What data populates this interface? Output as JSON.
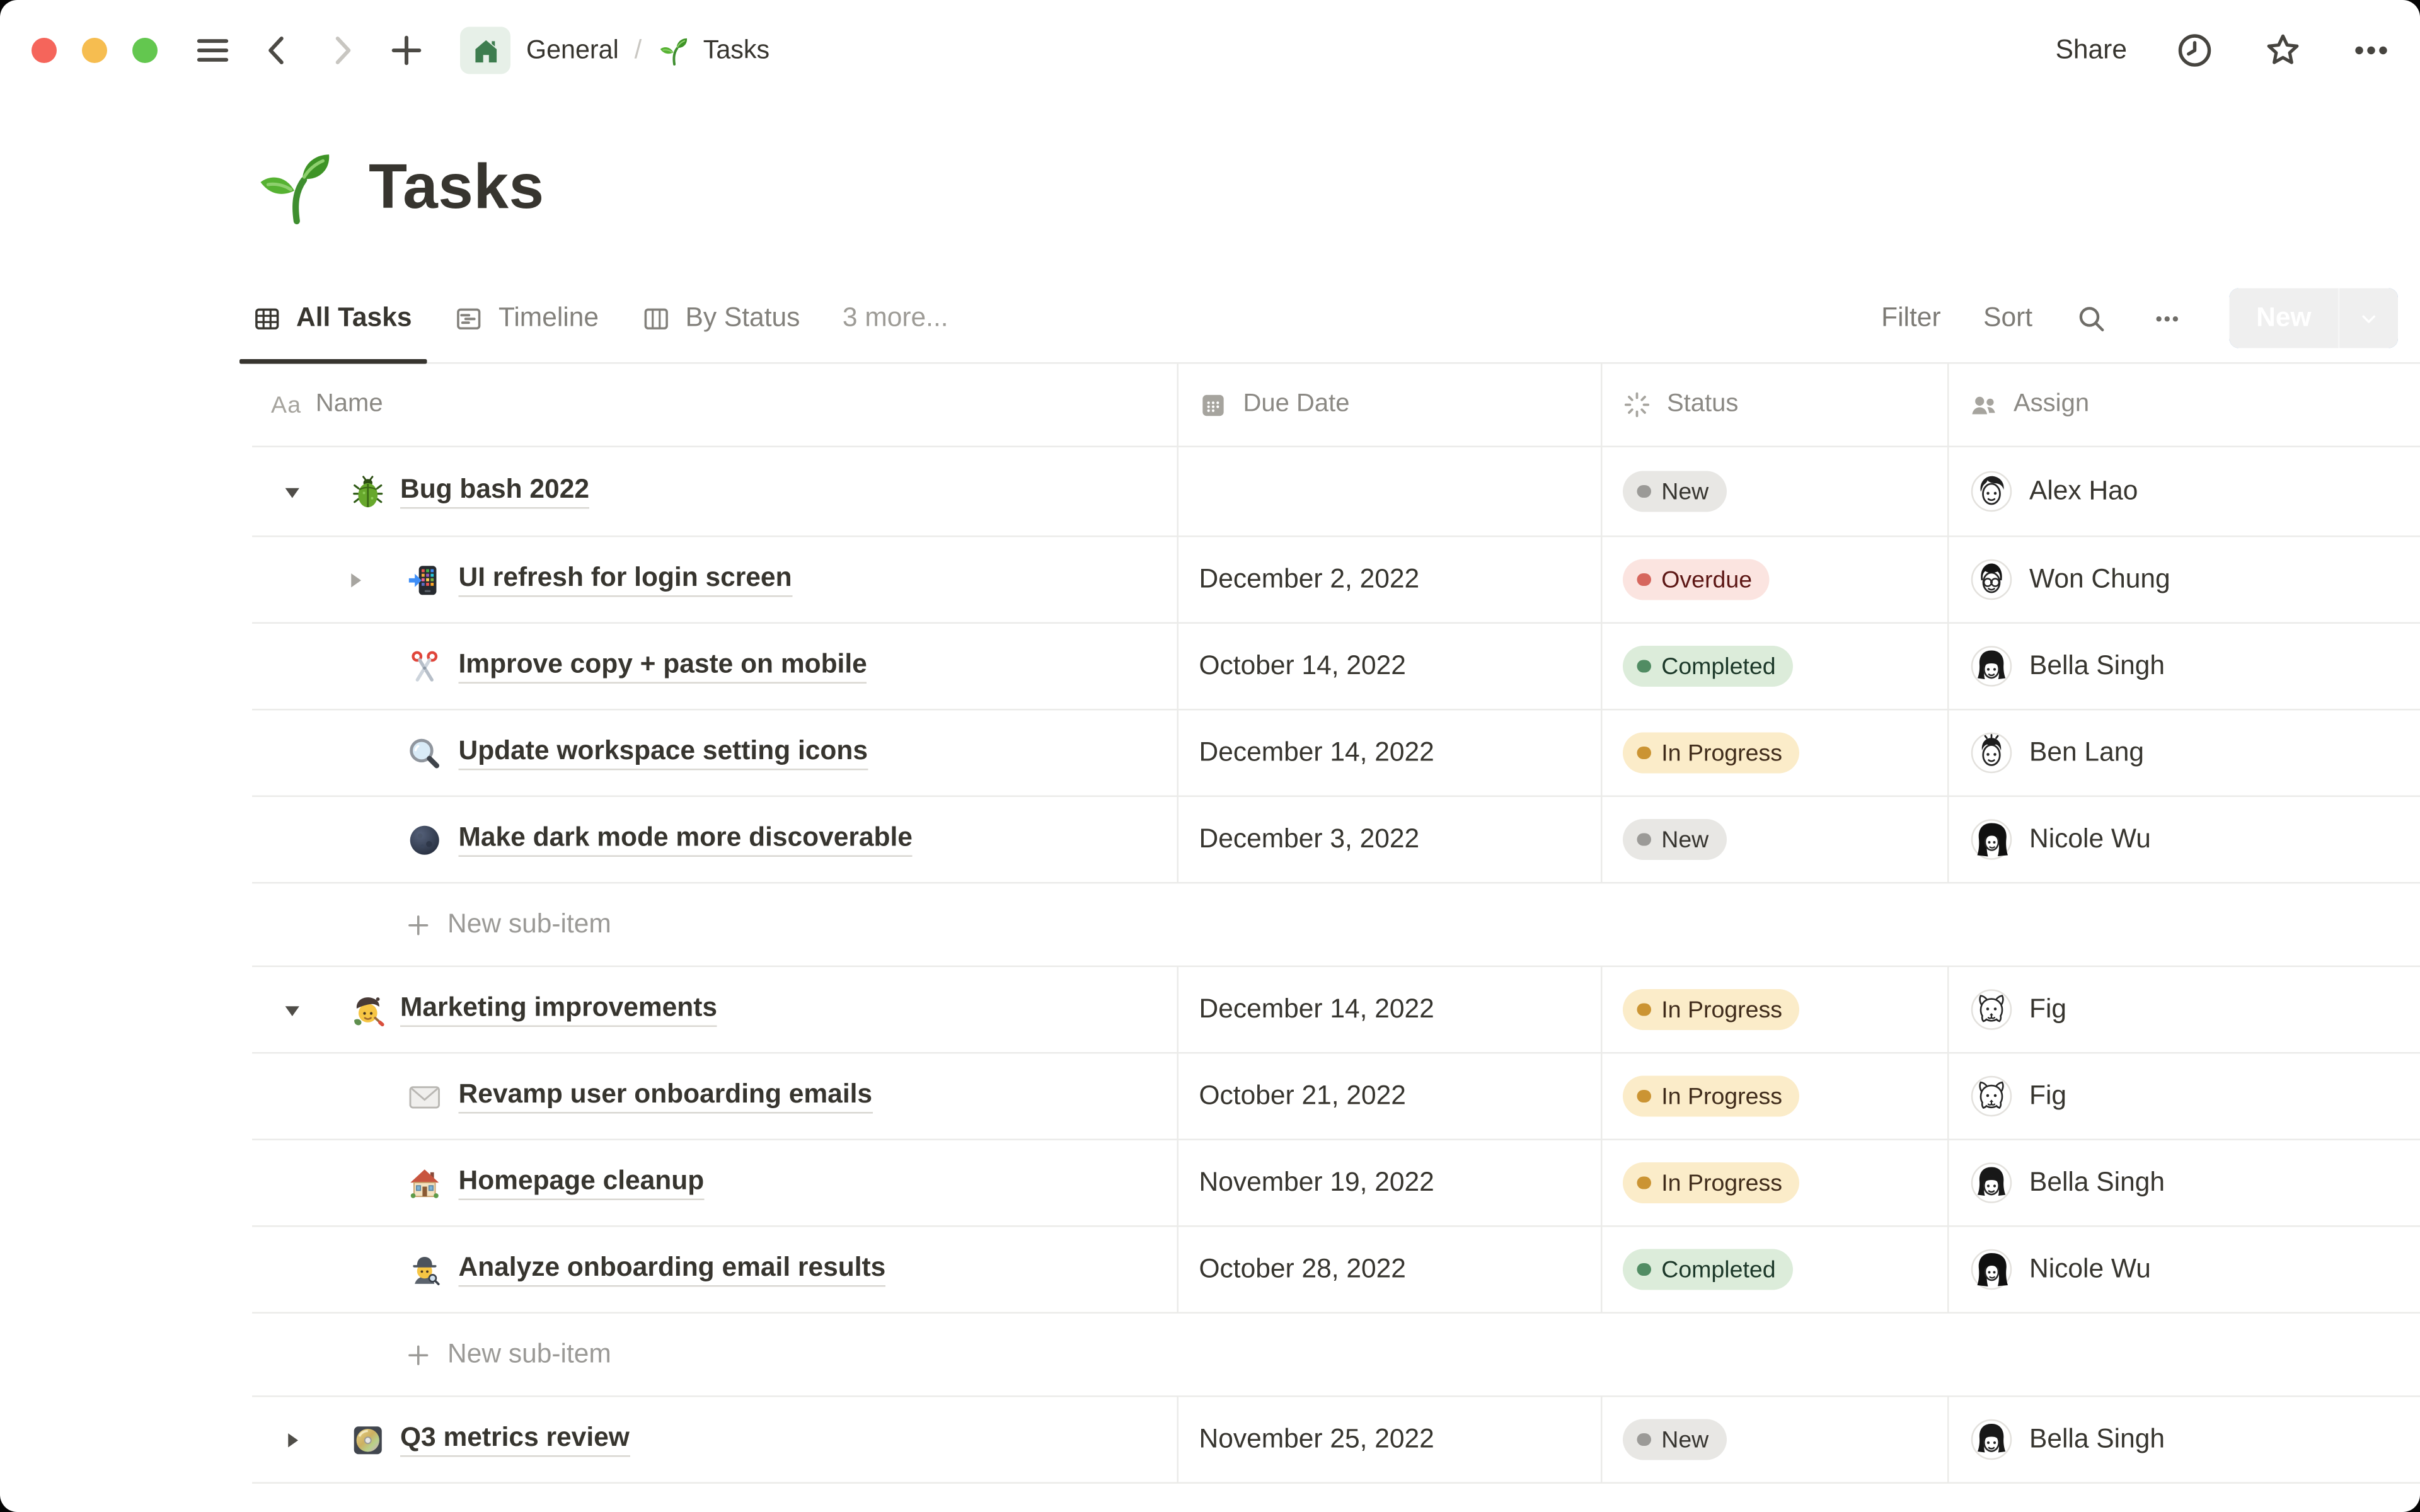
{
  "topbar": {
    "share": "Share",
    "icons": [
      "sidebar-menu",
      "back-chevron",
      "forward-chevron",
      "plus",
      "home",
      "clock",
      "star",
      "ellipsis"
    ]
  },
  "breadcrumb": {
    "workspace": "General",
    "separator": "/",
    "page": "Tasks",
    "page_emoji": "seedling"
  },
  "page": {
    "title": "Tasks",
    "emoji": "seedling"
  },
  "views": {
    "tabs": [
      {
        "label": "All Tasks",
        "icon": "table-grid",
        "active": true
      },
      {
        "label": "Timeline",
        "icon": "timeline",
        "active": false
      },
      {
        "label": "By Status",
        "icon": "board-columns",
        "active": false
      }
    ],
    "more_label": "3 more...",
    "toolbar": {
      "filter": "Filter",
      "sort": "Sort",
      "search_icon": "search",
      "more_icon": "ellipsis",
      "new_label": "New"
    }
  },
  "table": {
    "columns": [
      {
        "label": "Name",
        "icon": "text-Aa"
      },
      {
        "label": "Due Date",
        "icon": "calendar"
      },
      {
        "label": "Status",
        "icon": "status-burst"
      },
      {
        "label": "Assign",
        "icon": "people"
      }
    ],
    "new_sub_item_label": "New sub-item",
    "rows": [
      {
        "type": "task",
        "level": 0,
        "toggle": "open",
        "toggle_tone": "dark",
        "icon": "beetle",
        "name": "Bug bash 2022",
        "due": "",
        "status": "New",
        "assignee": "Alex Hao",
        "avatar": "man-sweep"
      },
      {
        "type": "task",
        "level": 1,
        "toggle": "closed",
        "toggle_tone": "muted",
        "icon": "phone-arrow",
        "name": "UI refresh for login screen",
        "due": "December 2, 2022",
        "status": "Overdue",
        "assignee": "Won Chung",
        "avatar": "man-glasses"
      },
      {
        "type": "task",
        "level": 1,
        "icon": "scissors",
        "name": "Improve copy + paste on mobile",
        "due": "October 14, 2022",
        "status": "Completed",
        "assignee": "Bella Singh",
        "avatar": "woman-bob"
      },
      {
        "type": "task",
        "level": 1,
        "icon": "magnifier",
        "name": "Update workspace setting icons",
        "due": "December 14, 2022",
        "status": "In Progress",
        "assignee": "Ben Lang",
        "avatar": "man-short"
      },
      {
        "type": "task",
        "level": 1,
        "icon": "new-moon",
        "name": "Make dark mode more discoverable",
        "due": "December 3, 2022",
        "status": "New",
        "assignee": "Nicole Wu",
        "avatar": "woman-long"
      },
      {
        "type": "new-sub-item"
      },
      {
        "type": "task",
        "level": 0,
        "toggle": "open",
        "toggle_tone": "dark",
        "icon": "artist",
        "name": "Marketing improvements",
        "due": "December 14, 2022",
        "status": "In Progress",
        "assignee": "Fig",
        "avatar": "dog"
      },
      {
        "type": "task",
        "level": 1,
        "icon": "envelope",
        "name": "Revamp user onboarding emails",
        "due": "October 21, 2022",
        "status": "In Progress",
        "assignee": "Fig",
        "avatar": "dog"
      },
      {
        "type": "task",
        "level": 1,
        "icon": "house",
        "name": "Homepage cleanup",
        "due": "November 19, 2022",
        "status": "In Progress",
        "assignee": "Bella Singh",
        "avatar": "woman-bob"
      },
      {
        "type": "task",
        "level": 1,
        "icon": "detective",
        "name": "Analyze onboarding email results",
        "due": "October 28, 2022",
        "status": "Completed",
        "assignee": "Nicole Wu",
        "avatar": "woman-long"
      },
      {
        "type": "new-sub-item"
      },
      {
        "type": "task",
        "level": 0,
        "toggle": "closed",
        "toggle_tone": "dark",
        "icon": "minidisc",
        "name": "Q3 metrics review",
        "due": "November 25, 2022",
        "status": "New",
        "assignee": "Bella Singh",
        "avatar": "woman-bob"
      }
    ],
    "status_styles": {
      "New": {
        "bg": "#e8e7e4",
        "dot": "#9b9a97",
        "text": "#373530"
      },
      "Overdue": {
        "bg": "#fbe4e0",
        "dot": "#d6665d",
        "text": "#5d1715"
      },
      "Completed": {
        "bg": "#dcecda",
        "dot": "#518c63",
        "text": "#1c3829"
      },
      "In Progress": {
        "bg": "#fbecc9",
        "dot": "#cb9433",
        "text": "#402c1b"
      }
    }
  },
  "colors": {
    "accent_blue": "#337dd3",
    "divider": "#ebebe9",
    "text": "#37352f",
    "muted_text": "#9b9a97"
  }
}
